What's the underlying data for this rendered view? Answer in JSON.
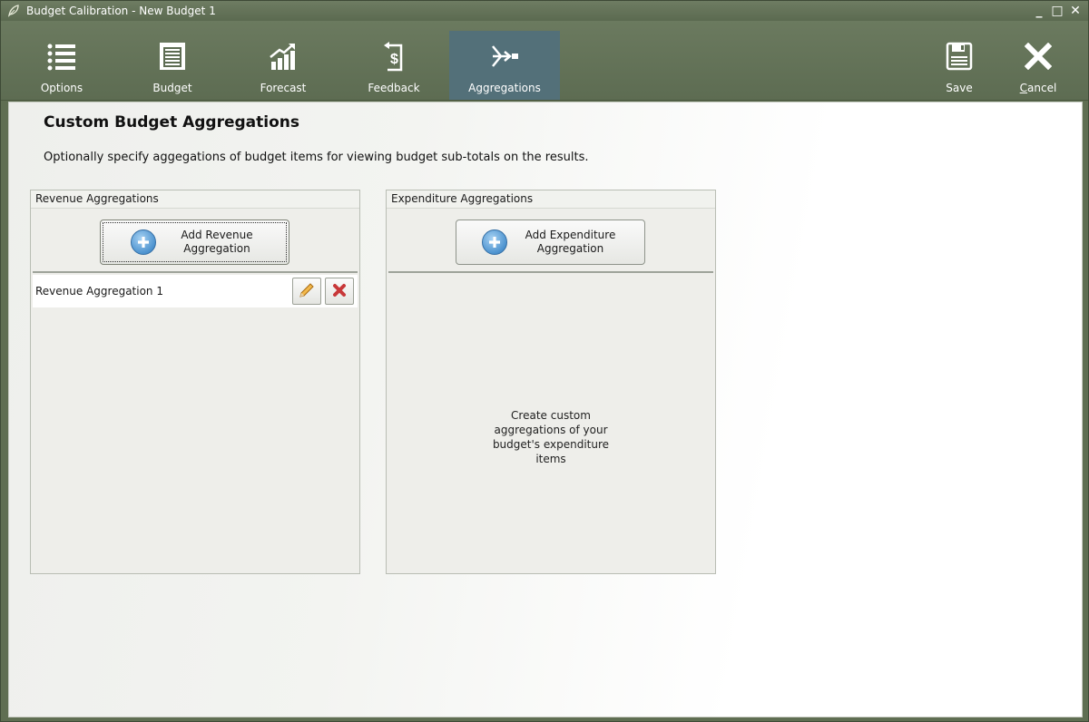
{
  "window": {
    "title": "Budget Calibration - New Budget 1",
    "controls": {
      "minimize": "_",
      "maximize": "□",
      "close": "✕"
    }
  },
  "toolbar": {
    "options_label": "Options",
    "budget_label": "Budget",
    "forecast_label": "Forecast",
    "feedback_label": "Feedback",
    "aggregations_label": "Aggregations",
    "save_label": "Save",
    "cancel_label_first": "C",
    "cancel_label_rest": "ancel",
    "active_tab": "aggregations"
  },
  "page": {
    "title": "Custom Budget Aggregations",
    "description": "Optionally specify aggegations of budget items for viewing budget sub-totals on the results."
  },
  "revenue_panel": {
    "header": "Revenue Aggregations",
    "add_button_label": "Add Revenue Aggregation",
    "items": [
      {
        "label": "Revenue Aggregation 1"
      }
    ]
  },
  "expenditure_panel": {
    "header": "Expenditure Aggregations",
    "add_button_label": "Add Expenditure Aggregation",
    "empty_message": "Create custom aggregations of your budget's expenditure items"
  },
  "colors": {
    "toolbar_bg": "#5f6e52",
    "active_tab_bg": "#537079",
    "panel_bg": "#eeeeea",
    "add_icon_blue": "#4d93cf",
    "edit_icon_orange": "#e8a23a",
    "delete_icon_red": "#c8383a"
  },
  "icons": {
    "options": "list-icon",
    "budget": "ledger-icon",
    "forecast": "growth-chart-icon",
    "feedback": "dollar-return-icon",
    "aggregations": "aggregate-flow-icon",
    "save": "floppy-disk-icon",
    "cancel": "x-icon",
    "add": "plus-circle-icon",
    "edit": "pencil-icon",
    "delete": "red-x-icon"
  }
}
